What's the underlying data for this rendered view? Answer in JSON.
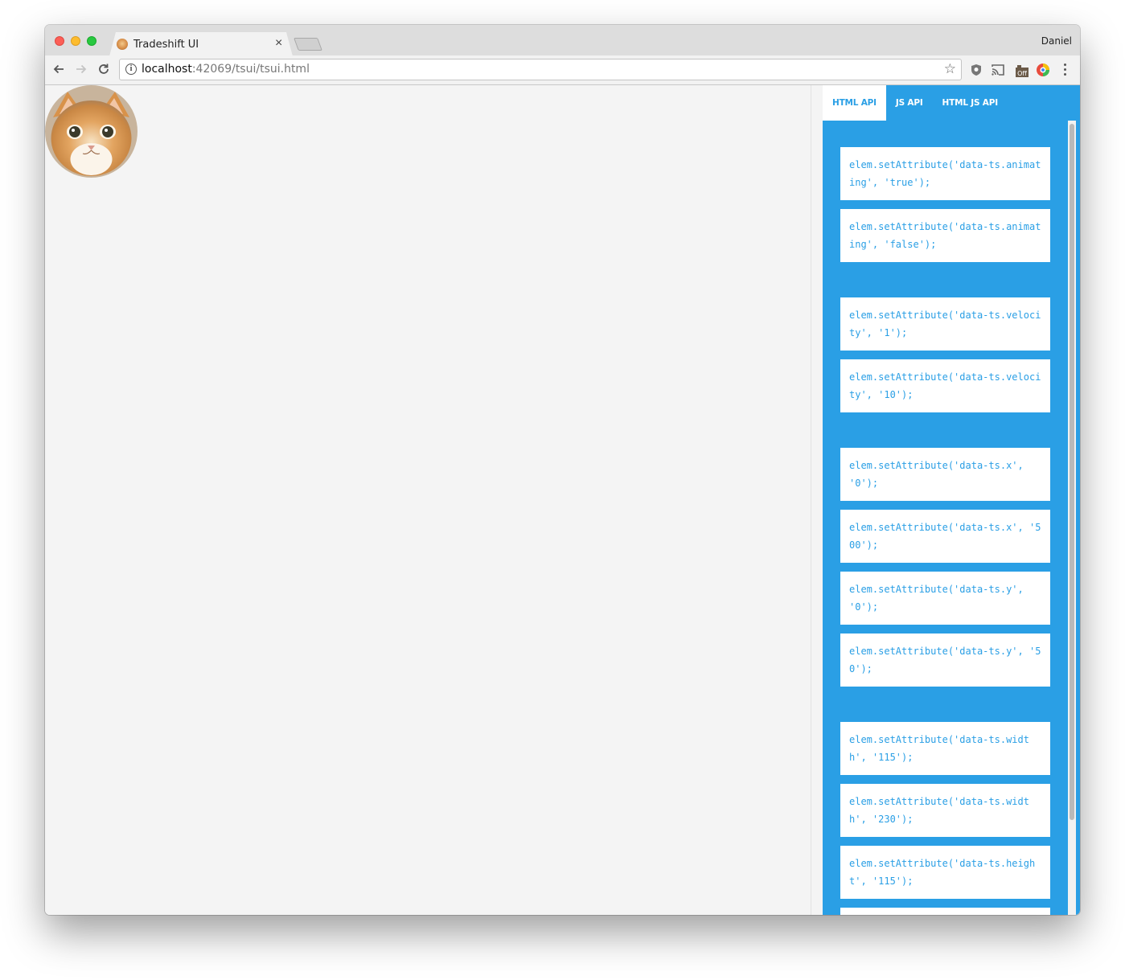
{
  "browser": {
    "tab_title": "Tradeshift UI",
    "tab_close": "×",
    "profile_name": "Daniel",
    "url_host": "localhost",
    "url_rest": ":42069/tsui/tsui.html"
  },
  "panel": {
    "tabs": [
      {
        "label": "HTML API",
        "active": true
      },
      {
        "label": "JS API",
        "active": false
      },
      {
        "label": "HTML JS API",
        "active": false
      }
    ],
    "groups": [
      [
        "elem.setAttribute('data-ts.animating', 'true');",
        "elem.setAttribute('data-ts.animating', 'false');"
      ],
      [
        "elem.setAttribute('data-ts.velocity', '1');",
        "elem.setAttribute('data-ts.velocity', '10');"
      ],
      [
        "elem.setAttribute('data-ts.x', '0');",
        "elem.setAttribute('data-ts.x', '500');",
        "elem.setAttribute('data-ts.y', '0');",
        "elem.setAttribute('data-ts.y', '50');"
      ],
      [
        "elem.setAttribute('data-ts.width', '115');",
        "elem.setAttribute('data-ts.width', '230');",
        "elem.setAttribute('data-ts.height', '115');",
        ""
      ]
    ]
  },
  "colors": {
    "panel_blue": "#2a9fe5",
    "page_bg": "#f4f4f4"
  },
  "icons": [
    "back-icon",
    "forward-icon",
    "reload-icon",
    "info-icon",
    "star-icon",
    "shield-extension-icon",
    "cast-icon",
    "off-extension-icon",
    "color-wheel-extension-icon",
    "menu-icon"
  ]
}
